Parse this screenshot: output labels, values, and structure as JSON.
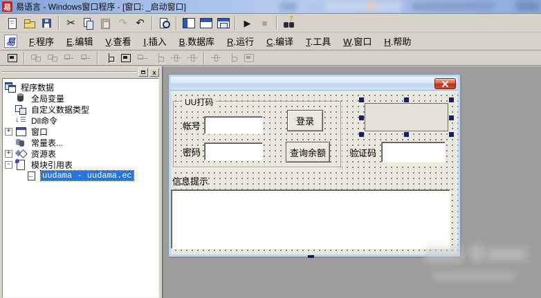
{
  "titlebar": {
    "app_glyph": "易",
    "title": "易语言 - Windows窗口程序 - [窗口: _启动窗口]"
  },
  "toolbar": {
    "buttons": [
      {
        "name": "new-file",
        "enabled": true
      },
      {
        "name": "open-file",
        "enabled": true
      },
      {
        "name": "save",
        "enabled": true
      },
      {
        "name": "cut",
        "enabled": true
      },
      {
        "name": "copy",
        "enabled": true
      },
      {
        "name": "paste",
        "enabled": false
      },
      {
        "name": "redo",
        "enabled": false
      },
      {
        "name": "undo",
        "enabled": true
      },
      {
        "name": "find",
        "enabled": true
      },
      {
        "name": "layout-left",
        "enabled": true
      },
      {
        "name": "layout-top",
        "enabled": true
      },
      {
        "name": "layout-split",
        "enabled": true
      },
      {
        "name": "run",
        "enabled": true
      },
      {
        "name": "stop",
        "enabled": false
      },
      {
        "name": "search-in-files",
        "enabled": true
      }
    ]
  },
  "menubar": {
    "logo_glyph": "易",
    "items": [
      {
        "hotkey": "F",
        "text": ".程序"
      },
      {
        "hotkey": "E",
        "text": ".编辑"
      },
      {
        "hotkey": "V",
        "text": ".查看"
      },
      {
        "hotkey": "I",
        "text": ".插入"
      },
      {
        "hotkey": "B",
        "text": ".数据库"
      },
      {
        "hotkey": "R",
        "text": ".运行"
      },
      {
        "hotkey": "C",
        "text": ".编译"
      },
      {
        "hotkey": "T",
        "text": ".工具"
      },
      {
        "hotkey": "W",
        "text": ".窗口"
      },
      {
        "hotkey": "H",
        "text": ".帮助"
      }
    ]
  },
  "form_toolbar": {
    "buttons": [
      {
        "name": "form-designer",
        "enabled": true
      },
      {
        "name": "align-left",
        "enabled": false
      },
      {
        "name": "align-right",
        "enabled": false
      },
      {
        "name": "align-top",
        "enabled": false
      },
      {
        "name": "align-bottom",
        "enabled": false
      },
      {
        "name": "center-horizontal",
        "enabled": true
      },
      {
        "name": "center-vertical",
        "enabled": true
      },
      {
        "name": "space-across",
        "enabled": false
      },
      {
        "name": "space-down",
        "enabled": false
      },
      {
        "name": "equal-horizontal-gap",
        "enabled": false
      },
      {
        "name": "equal-vertical-gap",
        "enabled": false
      },
      {
        "name": "same-width",
        "enabled": false
      },
      {
        "name": "same-height",
        "enabled": false
      },
      {
        "name": "same-size",
        "enabled": false
      }
    ]
  },
  "tree": {
    "root": "程序数据",
    "items": [
      {
        "label": "全局变量"
      },
      {
        "label": "自定义数据类型"
      },
      {
        "label": "Dll命令"
      },
      {
        "label": "窗口",
        "expander": "+"
      },
      {
        "label": "常量表..."
      },
      {
        "label": "资源表",
        "expander": "+"
      },
      {
        "label": "模块引用表",
        "expander": "-"
      },
      {
        "label": "uudama - uudama.ec",
        "selected": true
      }
    ]
  },
  "designer": {
    "form_title": "",
    "groupbox_title": "UU打码",
    "account_label": "帐号",
    "password_label": "密码",
    "login_button": "登录",
    "balance_button": "查询余额",
    "captcha_label": "验证码",
    "info_label": "信息提示"
  },
  "colors": {
    "titlebar_blue": "#a3bce6",
    "toolbar_gray": "#d7d3ca",
    "mdi_gray": "#9d9d9d",
    "dialog_face": "#ebe8e0",
    "dialog_border_blue": "#bfd7ef",
    "close_button_red": "#c03c28",
    "tree_selection_blue": "#2574e4",
    "selection_handle_navy": "#1b1b70"
  }
}
